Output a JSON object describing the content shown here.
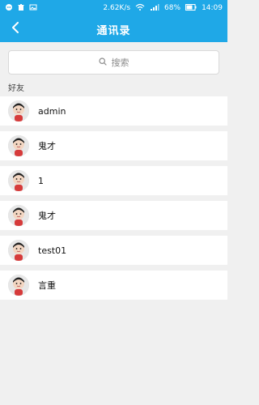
{
  "statusbar": {
    "speed": "2.62K/s",
    "battery": "68%",
    "time": "14:09"
  },
  "appbar": {
    "title": "通讯录"
  },
  "search": {
    "placeholder": "搜索"
  },
  "section": {
    "title": "好友"
  },
  "contacts": [
    {
      "name": "admin"
    },
    {
      "name": "鬼才"
    },
    {
      "name": "1"
    },
    {
      "name": "鬼才"
    },
    {
      "name": "test01"
    },
    {
      "name": "言重"
    }
  ],
  "colors": {
    "primary": "#1fa8e7",
    "background": "#f0f0f0"
  }
}
